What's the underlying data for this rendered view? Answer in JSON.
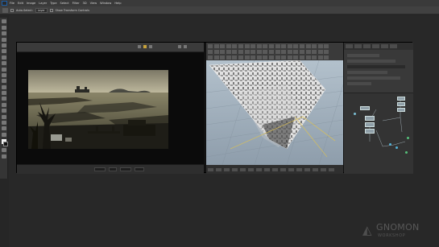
{
  "menubar": {
    "items": [
      "File",
      "Edit",
      "Image",
      "Layer",
      "Type",
      "Select",
      "Filter",
      "3D",
      "View",
      "Window",
      "Help"
    ]
  },
  "options_bar": {
    "auto_select_label": "Auto-Select:",
    "auto_select_value": "Layer",
    "transform_controls_label": "Show Transform Controls"
  },
  "colors": {
    "foreground": "#f0f0f0",
    "background": "#111111",
    "viewer_accent": "#c8a23a"
  },
  "icons": {
    "app_logo": "photoshop-logo-icon",
    "watermark_logo": "gnomon-logo-icon"
  },
  "watermark": {
    "name": "GNOMON",
    "subtitle": "WORKSHOP"
  }
}
